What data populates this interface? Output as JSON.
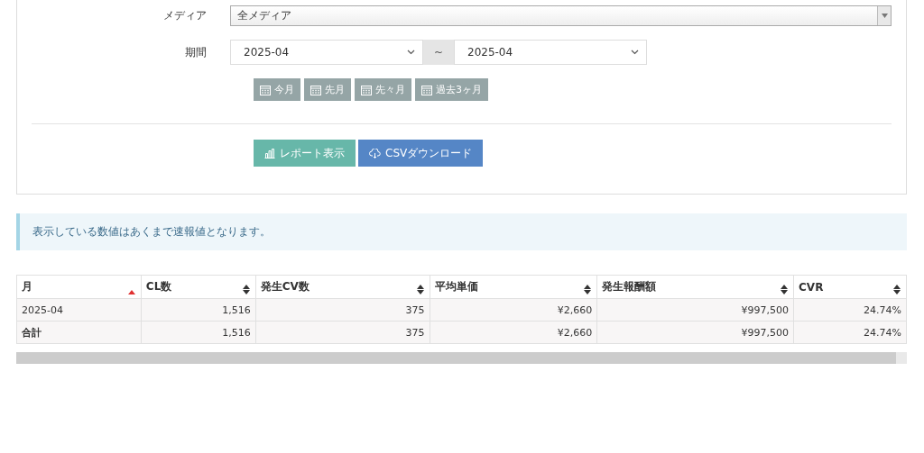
{
  "filters": [
    {
      "kind": "combo",
      "label": "メディア",
      "value": "全メディア"
    },
    {
      "kind": "range",
      "label": "期間",
      "from": "2025-04",
      "separator": "~",
      "to": "2025-04"
    }
  ],
  "quick_buttons": [
    "今月",
    "先月",
    "先々月",
    "過去3ヶ月"
  ],
  "actions": [
    {
      "kind": "report",
      "label": "レポート表示"
    },
    {
      "kind": "csv",
      "label": "CSVダウンロード"
    }
  ],
  "notice": "表示している数値はあくまで速報値となります。",
  "table": {
    "columns": [
      {
        "label": "月",
        "sorted": true
      },
      {
        "label": "CL数",
        "sorted": false
      },
      {
        "label": "発生CV数",
        "sorted": false
      },
      {
        "label": "平均単価",
        "sorted": false
      },
      {
        "label": "発生報酬額",
        "sorted": false
      },
      {
        "label": "CVR",
        "sorted": false
      }
    ],
    "rows": [
      {
        "kind": "data",
        "cells": [
          "2025-04",
          "1,516",
          "375",
          "¥2,660",
          "¥997,500",
          "24.74%"
        ]
      },
      {
        "kind": "total",
        "cells": [
          "合計",
          "1,516",
          "375",
          "¥2,660",
          "¥997,500",
          "24.74%"
        ]
      }
    ]
  }
}
